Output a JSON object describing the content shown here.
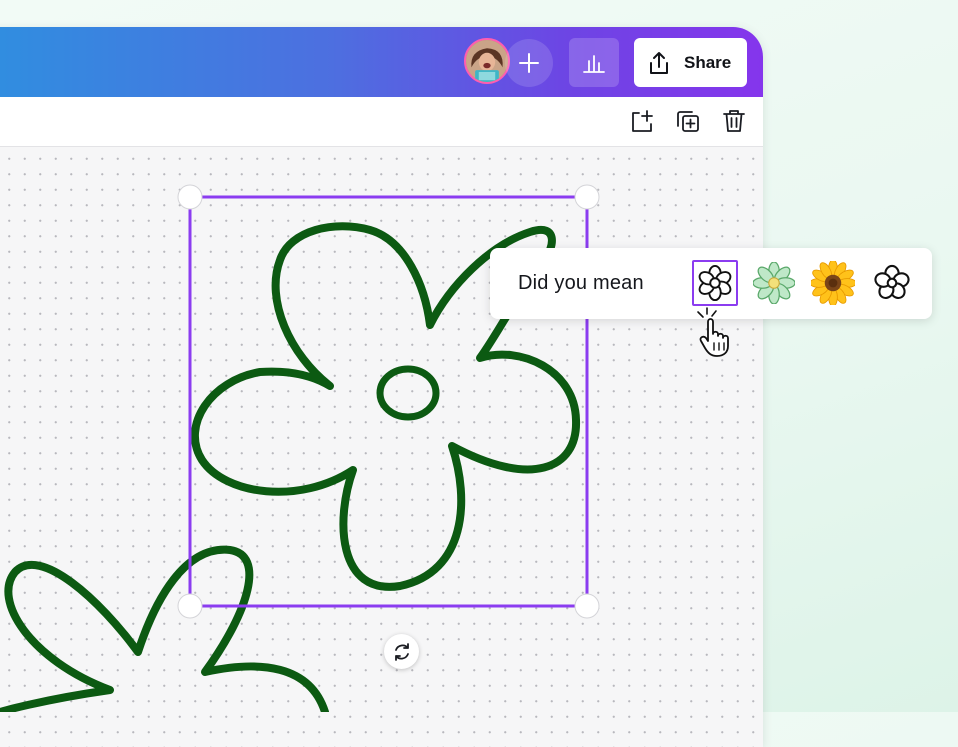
{
  "app": {
    "toolbar": {
      "share_label": "Share",
      "icons": [
        "plus-icon",
        "analytics-icon",
        "share-upload-icon"
      ]
    },
    "page_tools": [
      "add-page-icon",
      "duplicate-page-icon",
      "delete-page-icon"
    ],
    "suggestion": {
      "label": "Did you mean",
      "options": [
        "flower-outline",
        "flower-green",
        "sunflower",
        "flower-outline-alt"
      ],
      "selected": "flower-outline"
    },
    "colors": {
      "accent": "#8b3cf0",
      "drawing_stroke": "#0c5a12",
      "topbar_start": "#2f8fe0",
      "topbar_end": "#8535ec"
    }
  }
}
